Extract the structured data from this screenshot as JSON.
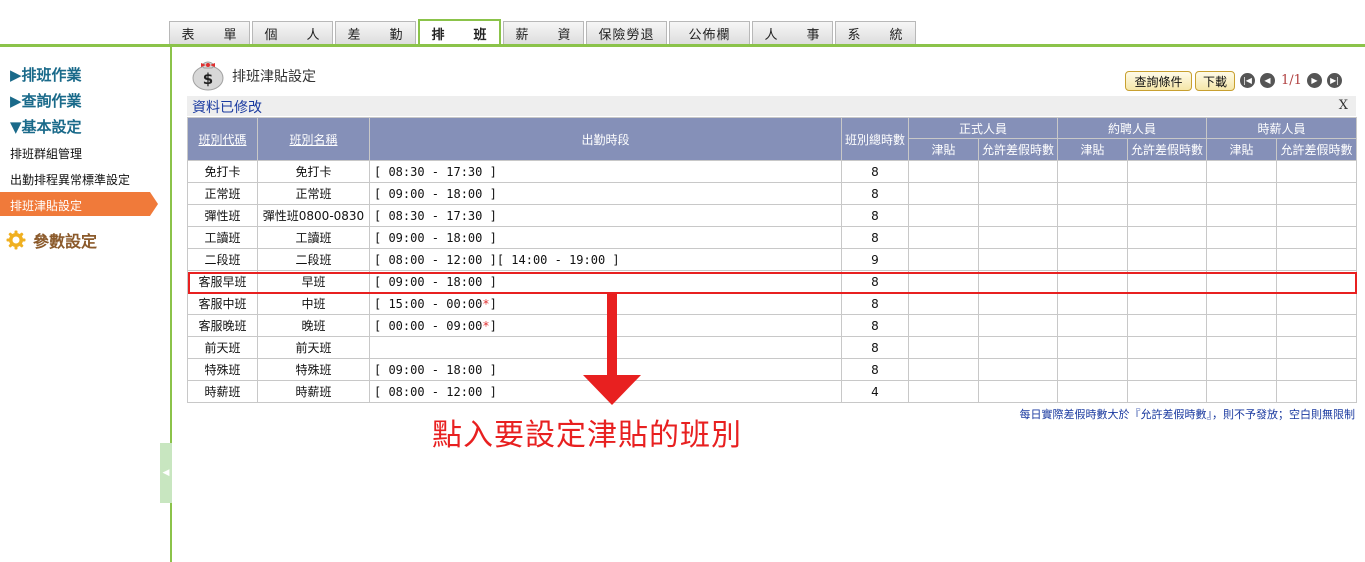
{
  "tabs": [
    "表　　單",
    "個　　人",
    "差　　勤",
    "排　　班",
    "薪　　資",
    "保險勞退",
    "公佈欄",
    "人　　事",
    "系　　統"
  ],
  "sidebar": {
    "sections": [
      "▶排班作業",
      "▶查詢作業",
      "▼基本設定"
    ],
    "subitems": [
      "排班群組管理",
      "出勤排程異常標準設定"
    ],
    "active_item": "排班津貼設定",
    "param_label": "參數設定"
  },
  "page": {
    "title": "排班津貼設定"
  },
  "toolbar": {
    "query_label": "查詢條件",
    "download_label": "下載",
    "page_info": "1/1"
  },
  "message": {
    "text": "資料已修改",
    "close": "X"
  },
  "table": {
    "headers": {
      "code": "班別代碼",
      "name": "班別名稱",
      "period": "出勤時段",
      "total_hours": "班別總時數",
      "groups": [
        "正式人員",
        "約聘人員",
        "時薪人員"
      ],
      "allowance": "津貼",
      "allowed_leave": "允許差假時數"
    },
    "rows": [
      {
        "code": "免打卡",
        "name": "免打卡",
        "period": "[ 08:30 - 17:30 ]",
        "star": "",
        "hours": "8"
      },
      {
        "code": "正常班",
        "name": "正常班",
        "period": "[ 09:00 - 18:00 ]",
        "star": "",
        "hours": "8"
      },
      {
        "code": "彈性班",
        "name": "彈性班0800-0830",
        "period": "[ 08:30 - 17:30 ]",
        "star": "",
        "hours": "8"
      },
      {
        "code": "工讀班",
        "name": "工讀班",
        "period": "[ 09:00 - 18:00 ]",
        "star": "",
        "hours": "8"
      },
      {
        "code": "二段班",
        "name": "二段班",
        "period": "[ 08:00 - 12:00 ][ 14:00 - 19:00 ]",
        "star": "",
        "hours": "9"
      },
      {
        "code": "客服早班",
        "name": "早班",
        "period": "[ 09:00 - 18:00 ]",
        "star": "",
        "hours": "8"
      },
      {
        "code": "客服中班",
        "name": "中班",
        "period": "[ 15:00 - 00:00",
        "star": "*",
        "period_end": "]",
        "hours": "8"
      },
      {
        "code": "客服晚班",
        "name": "晚班",
        "period": "[ 00:00 - 09:00",
        "star": "*",
        "period_end": "]",
        "hours": "8"
      },
      {
        "code": "前天班",
        "name": "前天班",
        "period": "",
        "star": "",
        "hours": "8"
      },
      {
        "code": "特殊班",
        "name": "特殊班",
        "period": "[ 09:00 - 18:00 ]",
        "star": "",
        "hours": "8"
      },
      {
        "code": "時薪班",
        "name": "時薪班",
        "period": "[ 08:00 - 12:00 ]",
        "star": "",
        "hours": "4"
      }
    ]
  },
  "footnote": "每日實際差假時數大於『允許差假時數』，則不予發放；空白則無限制",
  "annotation": "點入要設定津貼的班別",
  "colors": {
    "accent": "#8bc34a",
    "active": "#f07a3a",
    "header": "#8590b8",
    "highlight": "#e82020"
  }
}
